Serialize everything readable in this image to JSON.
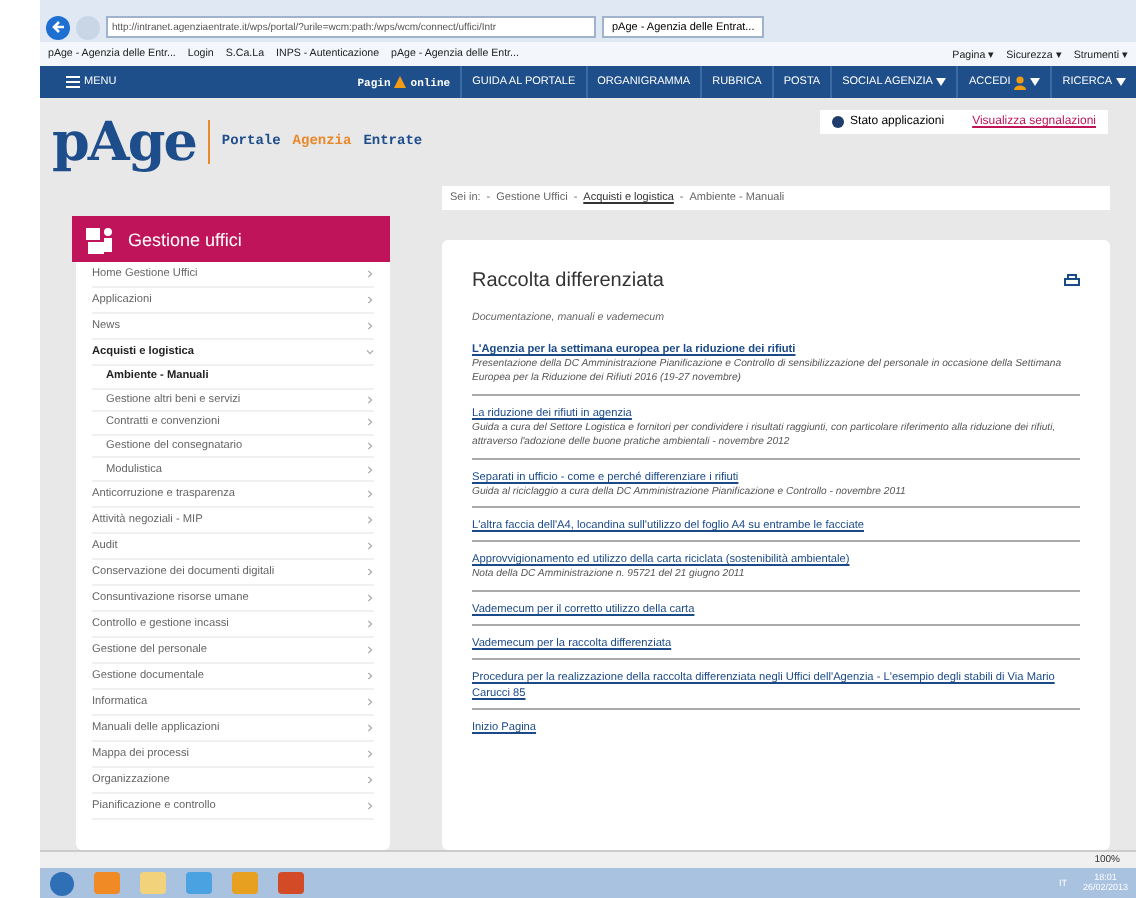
{
  "browser": {
    "address": "http://intranet.agenziaentrate.it/wps/portal/?urile=wcm:path:/wps/wcm/connect/uffici/Intr",
    "tabs": [
      {
        "label": "pAge - Agenzia delle Entrat...",
        "selected": true
      }
    ],
    "favorites": [
      "pAge - Agenzia delle Entr...",
      "Login",
      "S.Ca.La",
      "INPS - Autenticazione",
      "pAge - Agenzia delle Entr..."
    ],
    "tools": [
      "Pagina ▾",
      "Sicurezza ▾",
      "Strumenti ▾"
    ]
  },
  "nav": {
    "menu": "MENU",
    "brand_left": "Pagin",
    "brand_right": "online",
    "items": [
      {
        "label": "GUIDA AL PORTALE",
        "kind": "plain"
      },
      {
        "label": "ORGANIGRAMMA",
        "kind": "plain"
      },
      {
        "label": "RUBRICA",
        "kind": "plain"
      },
      {
        "label": "POSTA",
        "kind": "plain"
      },
      {
        "label": "SOCIAL AGENZIA",
        "kind": "dropdown"
      },
      {
        "label": "ACCEDI",
        "kind": "user"
      },
      {
        "label": "RICERCA",
        "kind": "dropdown"
      }
    ]
  },
  "header": {
    "logo": "pAge",
    "subtitle": [
      {
        "text": "Portale",
        "color": "#1e4d8c"
      },
      {
        "text": "Agenzia",
        "color": "#e8892a"
      },
      {
        "text": "Entrate",
        "color": "#1e4d8c"
      }
    ],
    "status": "Stato applicazioni",
    "alerts": "Visualizza segnalazioni"
  },
  "sidebar": {
    "title": "Gestione uffici",
    "items": [
      {
        "label": "Home Gestione Uffici",
        "expanded": false
      },
      {
        "label": "Applicazioni",
        "expanded": false
      },
      {
        "label": "News",
        "expanded": false
      },
      {
        "label": "Acquisti e logistica",
        "expanded": true,
        "children": [
          {
            "label": "Ambiente - Manuali",
            "selected": true
          },
          {
            "label": "Gestione altri beni e servizi",
            "selected": false
          },
          {
            "label": "Contratti e convenzioni",
            "selected": false
          },
          {
            "label": "Gestione del consegnatario",
            "selected": false
          },
          {
            "label": "Modulistica",
            "selected": false
          }
        ]
      },
      {
        "label": "Anticorruzione e trasparenza",
        "expanded": false
      },
      {
        "label": "Attività negoziali - MIP",
        "expanded": false
      },
      {
        "label": "Audit",
        "expanded": false
      },
      {
        "label": "Conservazione dei documenti digitali",
        "expanded": false
      },
      {
        "label": "Consuntivazione risorse umane",
        "expanded": false
      },
      {
        "label": "Controllo e gestione incassi",
        "expanded": false
      },
      {
        "label": "Gestione del personale",
        "expanded": false
      },
      {
        "label": "Gestione documentale",
        "expanded": false
      },
      {
        "label": "Informatica",
        "expanded": false
      },
      {
        "label": "Manuali delle applicazioni",
        "expanded": false
      },
      {
        "label": "Mappa dei processi",
        "expanded": false
      },
      {
        "label": "Organizzazione",
        "expanded": false
      },
      {
        "label": "Pianificazione e controllo",
        "expanded": false
      }
    ]
  },
  "breadcrumb": [
    {
      "label": "Sei in:",
      "kind": "text"
    },
    {
      "label": "-",
      "kind": "separator"
    },
    {
      "label": "Gestione Uffici",
      "kind": "text"
    },
    {
      "label": "-",
      "kind": "separator"
    },
    {
      "label": "Acquisti e logistica",
      "kind": "link"
    },
    {
      "label": "-",
      "kind": "separator"
    },
    {
      "label": "Ambiente - Manuali",
      "kind": "text"
    }
  ],
  "content": {
    "title": "Raccolta differenziata",
    "intro": "Documentazione, manuali e vademecum",
    "links": [
      {
        "label": "L'Agenzia per la settimana europea per la riduzione dei rifiuti",
        "kind": "bold",
        "description": "Presentazione della DC Amministrazione Pianificazione e Controllo di sensibilizzazione del personale in occasione della Settimana Europea per la Riduzione dei Rifiuti 2016 (19-27 novembre)"
      },
      {
        "label": "La riduzione dei rifiuti in agenzia",
        "kind": "plain",
        "description": "Guida a cura del Settore Logistica e fornitori per condividere i risultati raggiunti, con particolare riferimento alla riduzione dei rifiuti, attraverso l'adozione delle buone pratiche ambientali - novembre 2012"
      },
      {
        "label": "Separati in ufficio - come e perché differenziare i rifiuti",
        "kind": "plain",
        "description": "Guida al riciclaggio a cura della DC Amministrazione Pianificazione e Controllo - novembre 2011"
      },
      {
        "label": "L'altra faccia dell'A4, locandina sull'utilizzo del foglio A4 su entrambe le facciate",
        "kind": "plain"
      },
      {
        "label": "Approvvigionamento ed utilizzo della carta riciclata (sostenibilità ambientale)",
        "kind": "plain",
        "description": "Nota della DC Amministrazione n. 95721 del 21 giugno 2011"
      },
      {
        "label": "Vademecum per il corretto utilizzo della carta",
        "kind": "plain"
      },
      {
        "label": "Vademecum per la raccolta differenziata",
        "kind": "plain"
      },
      {
        "label": "Procedura per la realizzazione della raccolta differenziata negli Uffici dell'Agenzia - L'esempio degli stabili di Via Mario Carucci 85",
        "kind": "plain"
      }
    ],
    "top_link": "Inizio Pagina"
  },
  "status_bar": {
    "zoom": "100%"
  },
  "taskbar": {
    "language": "IT",
    "time": "18:01",
    "date": "26/02/2013"
  }
}
